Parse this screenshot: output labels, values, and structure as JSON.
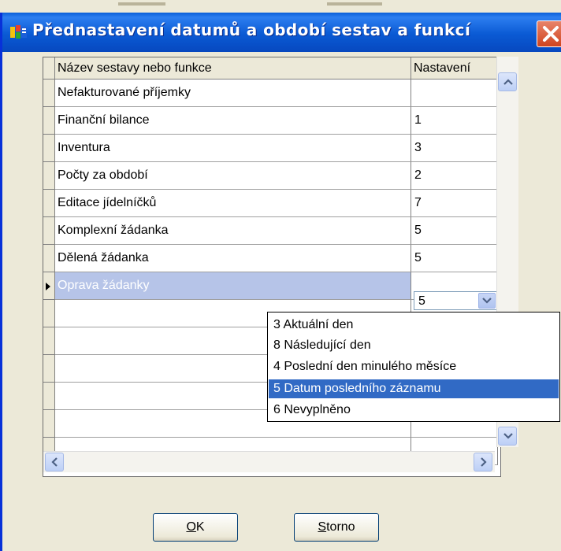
{
  "window": {
    "title": "Přednastavení datumů a období sestav a funkcí"
  },
  "grid": {
    "columns": [
      "Název sestavy nebo funkce",
      "Nastavení"
    ],
    "rows": [
      {
        "name": "Nefakturované příjemky",
        "setting": ""
      },
      {
        "name": "Finanční bilance",
        "setting": "1"
      },
      {
        "name": "Inventura",
        "setting": "3"
      },
      {
        "name": "Počty za období",
        "setting": "2"
      },
      {
        "name": "Editace jídelníčků",
        "setting": "7"
      },
      {
        "name": "Komplexní žádanka",
        "setting": "5"
      },
      {
        "name": "Dělená žádanka",
        "setting": "5"
      },
      {
        "name": "Oprava žádanky",
        "setting": "5"
      }
    ],
    "selected_row": 7
  },
  "dropdown": {
    "options": [
      "3  Aktuální den",
      "8  Následující den",
      "4  Poslední den minulého měsíce",
      "5  Datum posledního záznamu",
      "6  Nevyplněno"
    ],
    "selected_option": 3
  },
  "buttons": {
    "ok": "OK",
    "storno": "Storno"
  },
  "colors": {
    "titlebar": "#0a5ad4",
    "selection": "#316ac5",
    "row_selection": "#b6c4e8"
  }
}
